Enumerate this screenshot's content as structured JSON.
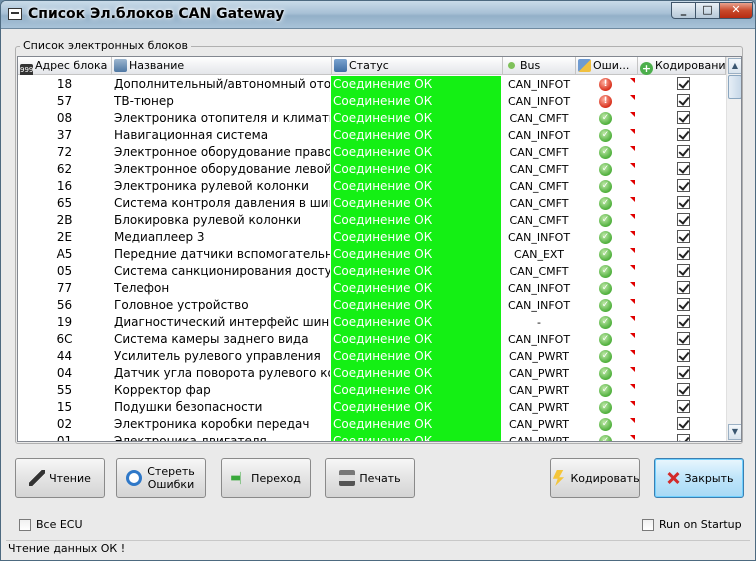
{
  "window": {
    "title": "Список Эл.блоков CAN Gateway"
  },
  "group": {
    "label": "Список электронных блоков"
  },
  "columns": {
    "addr": "Адрес блока",
    "name": "Название",
    "status": "Статус",
    "bus": "Bus",
    "err": "Оши...",
    "code": "Кодирование"
  },
  "rows": [
    {
      "addr": "18",
      "name": "Дополнительный/автономный отоп...",
      "status": "Соединение ОК",
      "bus": "CAN_INFOT",
      "err": "error",
      "code": true
    },
    {
      "addr": "57",
      "name": "ТВ-тюнер",
      "status": "Соединение ОК",
      "bus": "CAN_INFOT",
      "err": "error",
      "code": true
    },
    {
      "addr": "08",
      "name": "Электроника отопителя и климати...",
      "status": "Соединение ОК",
      "bus": "CAN_CMFT",
      "err": "ok",
      "code": true
    },
    {
      "addr": "37",
      "name": "Навигационная система",
      "status": "Соединение ОК",
      "bus": "CAN_INFOT",
      "err": "ok",
      "code": true
    },
    {
      "addr": "72",
      "name": "Электронное оборудование право...",
      "status": "Соединение ОК",
      "bus": "CAN_CMFT",
      "err": "ok",
      "code": true
    },
    {
      "addr": "62",
      "name": "Электронное оборудование левой ...",
      "status": "Соединение ОК",
      "bus": "CAN_CMFT",
      "err": "ok",
      "code": true
    },
    {
      "addr": "16",
      "name": "Электроника рулевой колонки",
      "status": "Соединение ОК",
      "bus": "CAN_CMFT",
      "err": "ok",
      "code": true
    },
    {
      "addr": "65",
      "name": "Система контроля давления в шинах",
      "status": "Соединение ОК",
      "bus": "CAN_CMFT",
      "err": "ok",
      "code": true
    },
    {
      "addr": "2B",
      "name": "Блокировка рулевой колонки",
      "status": "Соединение ОК",
      "bus": "CAN_CMFT",
      "err": "ok",
      "code": true
    },
    {
      "addr": "2E",
      "name": "Медиаплеер 3",
      "status": "Соединение ОК",
      "bus": "CAN_INFOT",
      "err": "ok",
      "code": true
    },
    {
      "addr": "A5",
      "name": "Передние датчики вспомогательн...",
      "status": "Соединение ОК",
      "bus": "CAN_EXT",
      "err": "ok",
      "code": true
    },
    {
      "addr": "05",
      "name": "Система санкционирования доступ...",
      "status": "Соединение ОК",
      "bus": "CAN_CMFT",
      "err": "ok",
      "code": true
    },
    {
      "addr": "77",
      "name": "Телефон",
      "status": "Соединение ОК",
      "bus": "CAN_INFOT",
      "err": "ok",
      "code": true
    },
    {
      "addr": "56",
      "name": "Головное устройство",
      "status": "Соединение ОК",
      "bus": "CAN_INFOT",
      "err": "ok",
      "code": true
    },
    {
      "addr": "19",
      "name": "Диагностический интерфейс шин ...",
      "status": "Соединение ОК",
      "bus": "-",
      "err": "ok",
      "code": true
    },
    {
      "addr": "6C",
      "name": "Система камеры заднего вида",
      "status": "Соединение ОК",
      "bus": "CAN_INFOT",
      "err": "ok",
      "code": true
    },
    {
      "addr": "44",
      "name": "Усилитель рулевого управления",
      "status": "Соединение ОК",
      "bus": "CAN_PWRT",
      "err": "ok",
      "code": true
    },
    {
      "addr": "04",
      "name": "Датчик угла поворота рулевого ко...",
      "status": "Соединение ОК",
      "bus": "CAN_PWRT",
      "err": "ok",
      "code": true
    },
    {
      "addr": "55",
      "name": "Корректор фар",
      "status": "Соединение ОК",
      "bus": "CAN_PWRT",
      "err": "ok",
      "code": true
    },
    {
      "addr": "15",
      "name": "Подушки безопасности",
      "status": "Соединение ОК",
      "bus": "CAN_PWRT",
      "err": "ok",
      "code": true
    },
    {
      "addr": "02",
      "name": "Электроника коробки передач",
      "status": "Соединение ОК",
      "bus": "CAN_PWRT",
      "err": "ok",
      "code": true
    },
    {
      "addr": "01",
      "name": "Электроника двигателя",
      "status": "Соединение ОК",
      "bus": "CAN_PWRT",
      "err": "ok",
      "code": true
    }
  ],
  "buttons": {
    "read": "Чтение",
    "clear": "Стереть Ошибки",
    "go": "Переход",
    "print": "Печать",
    "coding": "Кодировать",
    "close": "Закрыть"
  },
  "options": {
    "all_ecu": "Все ECU",
    "run_on_startup": "Run on Startup"
  },
  "status": {
    "text": "Чтение данных ОК !"
  },
  "colors": {
    "status_ok_bg": "#14f014",
    "accent": "#3c7fb1"
  },
  "icons": {
    "read": "key-icon",
    "clear": "eraser-icon",
    "go": "arrow-right-icon",
    "print": "printer-icon",
    "coding": "lightning-icon",
    "close": "close-icon"
  }
}
